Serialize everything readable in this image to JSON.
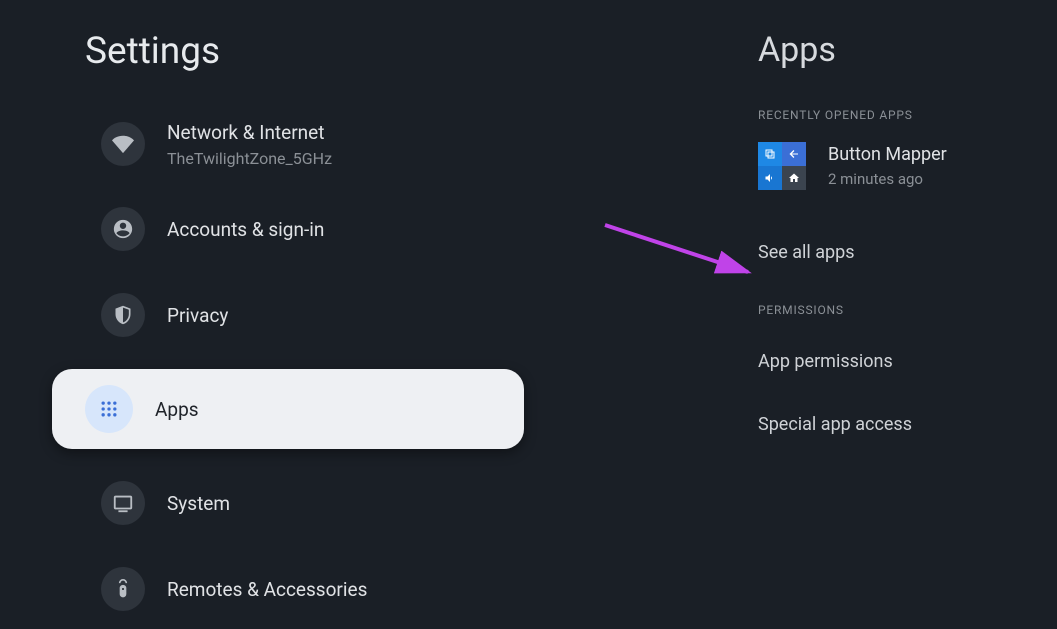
{
  "left": {
    "title": "Settings",
    "items": [
      {
        "label": "Network & Internet",
        "sub": "TheTwilightZone_5GHz"
      },
      {
        "label": "Accounts & sign-in"
      },
      {
        "label": "Privacy"
      },
      {
        "label": "Apps"
      },
      {
        "label": "System"
      },
      {
        "label": "Remotes & Accessories"
      }
    ]
  },
  "right": {
    "title": "Apps",
    "recent_header": "Recently opened apps",
    "recent_app": {
      "name": "Button Mapper",
      "time": "2 minutes ago"
    },
    "see_all": "See all apps",
    "perm_header": "Permissions",
    "app_permissions": "App permissions",
    "special_access": "Special app access"
  }
}
